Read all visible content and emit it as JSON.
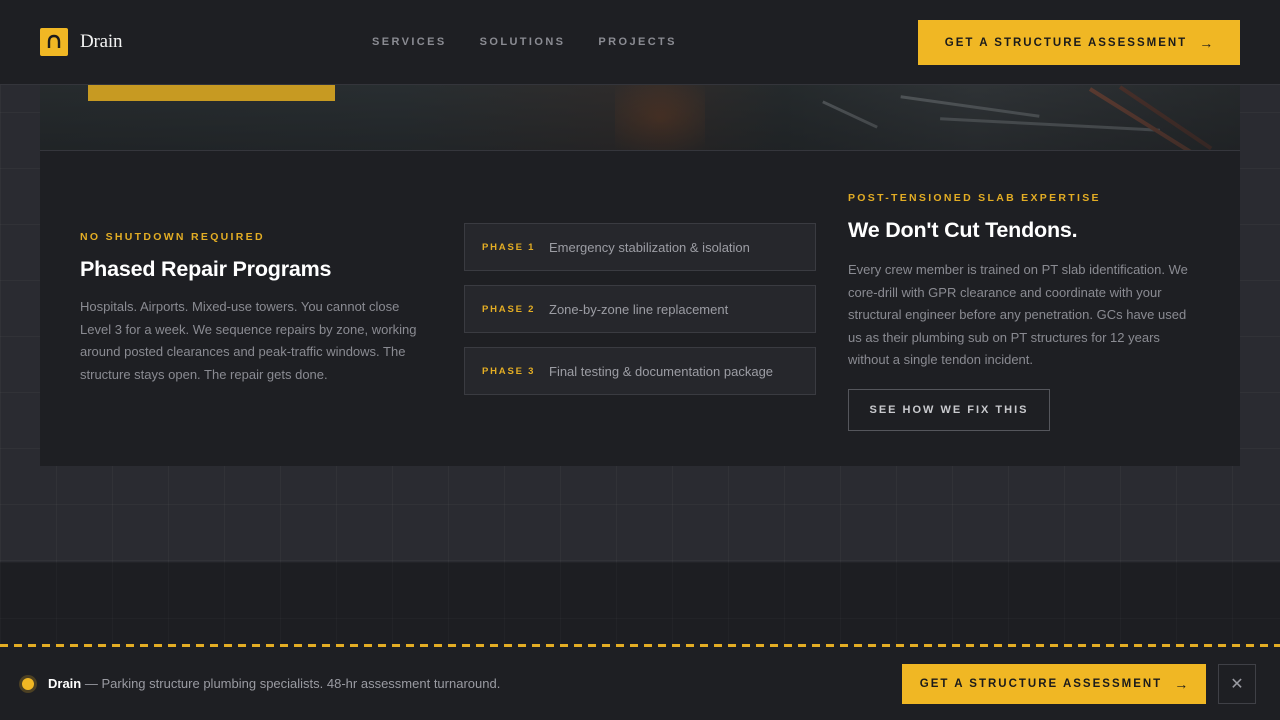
{
  "brand": {
    "name": "Drain"
  },
  "nav": {
    "items": [
      "SERVICES",
      "SOLUTIONS",
      "PROJECTS"
    ]
  },
  "header_cta": {
    "label": "GET A STRUCTURE ASSESSMENT",
    "icon": "arrow-right-icon"
  },
  "phased": {
    "eyebrow": "NO SHUTDOWN REQUIRED",
    "title": "Phased Repair Programs",
    "body": "Hospitals. Airports. Mixed-use towers. You cannot close Level 3 for a week. We sequence repairs by zone, working around posted clearances and peak-traffic windows. The structure stays open. The repair gets done."
  },
  "phases": [
    {
      "tag": "PHASE 1",
      "text": "Emergency stabilization & isolation"
    },
    {
      "tag": "PHASE 2",
      "text": "Zone-by-zone line replacement"
    },
    {
      "tag": "PHASE 3",
      "text": "Final testing & documentation package"
    }
  ],
  "expertise": {
    "eyebrow": "POST-TENSIONED SLAB EXPERTISE",
    "title": "We Don't Cut Tendons.",
    "body": "Every crew member is trained on PT slab identification. We core-drill with GPR clearance and coordinate with your structural engineer before any penetration. GCs have used us as their plumbing sub on PT structures for 12 years without a single tendon incident.",
    "button": "SEE HOW WE FIX THIS"
  },
  "bottom_bar": {
    "brand": "Drain",
    "message": " — Parking structure plumbing specialists. 48-hr assessment turnaround.",
    "cta": "GET A STRUCTURE ASSESSMENT",
    "close": "✕"
  },
  "colors": {
    "accent": "#f0b724",
    "panel": "#1e1f23",
    "background": "#2a2b31"
  }
}
